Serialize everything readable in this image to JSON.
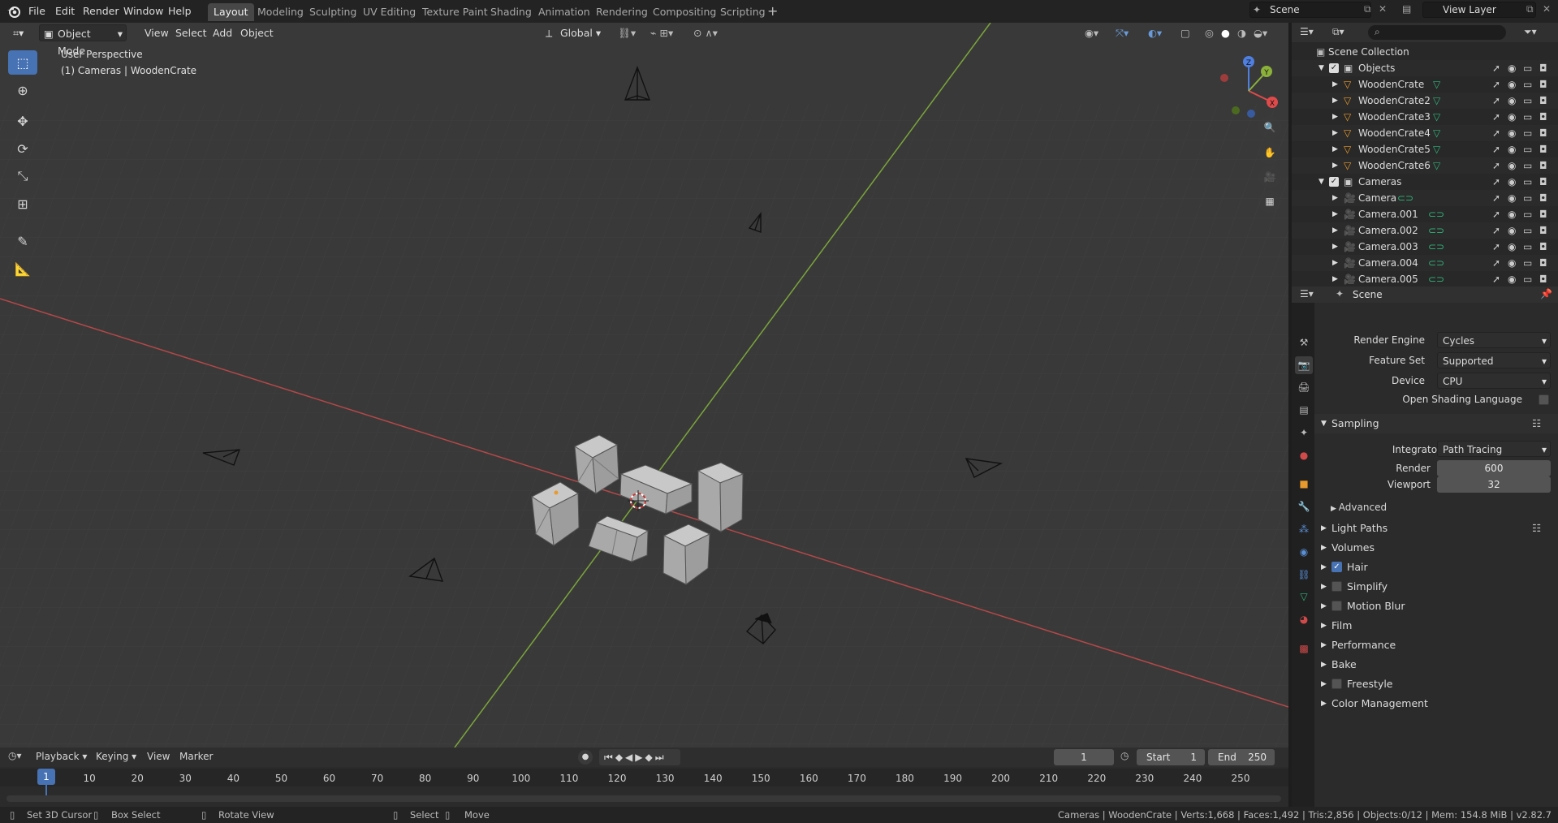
{
  "topbar": {
    "menu": [
      "File",
      "Edit",
      "Render",
      "Window",
      "Help"
    ],
    "workspaces": [
      "Layout",
      "Modeling",
      "Sculpting",
      "UV Editing",
      "Texture Paint",
      "Shading",
      "Animation",
      "Rendering",
      "Compositing",
      "Scripting"
    ],
    "active_workspace": "Layout",
    "scene_field": "Scene",
    "view_layer_field": "View Layer"
  },
  "viewport": {
    "mode": "Object Mode",
    "menus": [
      "View",
      "Select",
      "Add",
      "Object"
    ],
    "orientation": "Global",
    "info_line1": "User Perspective",
    "info_line2": "(1) Cameras | WoodenCrate",
    "gizmo": {
      "x": "X",
      "y": "Y",
      "z": "Z"
    }
  },
  "outliner": {
    "root": "Scene Collection",
    "collections": [
      {
        "name": "Objects",
        "items": [
          "WoodenCrate",
          "WoodenCrate2",
          "WoodenCrate3",
          "WoodenCrate4",
          "WoodenCrate5",
          "WoodenCrate6"
        ]
      },
      {
        "name": "Cameras",
        "items": [
          "Camera",
          "Camera.001",
          "Camera.002",
          "Camera.003",
          "Camera.004",
          "Camera.005"
        ]
      }
    ]
  },
  "properties": {
    "context": "Scene",
    "render_engine_label": "Render Engine",
    "render_engine": "Cycles",
    "feature_set_label": "Feature Set",
    "feature_set": "Supported",
    "device_label": "Device",
    "device": "CPU",
    "osl_label": "Open Shading Language",
    "sampling": {
      "title": "Sampling",
      "integrator_label": "Integrator",
      "integrator": "Path Tracing",
      "render_label": "Render",
      "render": "600",
      "viewport_label": "Viewport",
      "viewport": "32",
      "advanced": "Advanced"
    },
    "panels": [
      {
        "label": "Light Paths",
        "checkbox": null
      },
      {
        "label": "Volumes",
        "checkbox": null
      },
      {
        "label": "Hair",
        "checkbox": true
      },
      {
        "label": "Simplify",
        "checkbox": false
      },
      {
        "label": "Motion Blur",
        "checkbox": false
      },
      {
        "label": "Film",
        "checkbox": null
      },
      {
        "label": "Performance",
        "checkbox": null
      },
      {
        "label": "Bake",
        "checkbox": null
      },
      {
        "label": "Freestyle",
        "checkbox": false
      },
      {
        "label": "Color Management",
        "checkbox": null
      }
    ]
  },
  "timeline": {
    "menus": [
      "Playback",
      "Keying",
      "View",
      "Marker"
    ],
    "current_frame": "1",
    "start_label": "Start",
    "start": "1",
    "end_label": "End",
    "end": "250",
    "ticks": [
      "1",
      "10",
      "20",
      "30",
      "40",
      "50",
      "60",
      "70",
      "80",
      "90",
      "100",
      "110",
      "120",
      "130",
      "140",
      "150",
      "160",
      "170",
      "180",
      "190",
      "200",
      "210",
      "220",
      "230",
      "240",
      "250"
    ]
  },
  "statusbar": {
    "set_cursor": "Set 3D Cursor",
    "box_select": "Box Select",
    "rotate_view": "Rotate View",
    "select": "Select",
    "move": "Move",
    "stats": "Cameras | WoodenCrate | Verts:1,668 | Faces:1,492 | Tris:2,856 | Objects:0/12 | Mem: 154.8 MiB | v2.82.7"
  },
  "colors": {
    "accent": "#4772b3",
    "x_axis": "#c84444",
    "y_axis": "#8bb13a",
    "viewport_bg": "#3a3a3a"
  }
}
